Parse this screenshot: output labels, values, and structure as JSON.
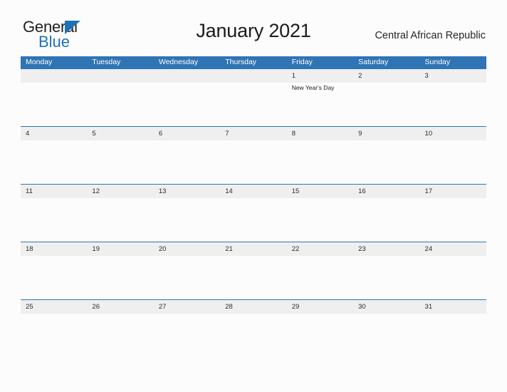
{
  "logo": {
    "word_one": "General",
    "word_two": "Blue",
    "triangle_icon": "triangle-icon",
    "brand_color": "#1f72ba",
    "text_color": "#231f20"
  },
  "header": {
    "title": "January 2021",
    "region": "Central African Republic"
  },
  "calendar": {
    "month": "January",
    "year": "2021",
    "header_bg": "#2f74b5",
    "date_band_bg": "#efefef",
    "weekdays": [
      "Monday",
      "Tuesday",
      "Wednesday",
      "Thursday",
      "Friday",
      "Saturday",
      "Sunday"
    ],
    "weeks": [
      [
        {
          "date": "",
          "events": []
        },
        {
          "date": "",
          "events": []
        },
        {
          "date": "",
          "events": []
        },
        {
          "date": "",
          "events": []
        },
        {
          "date": "1",
          "events": [
            "New Year's Day"
          ]
        },
        {
          "date": "2",
          "events": []
        },
        {
          "date": "3",
          "events": []
        }
      ],
      [
        {
          "date": "4",
          "events": []
        },
        {
          "date": "5",
          "events": []
        },
        {
          "date": "6",
          "events": []
        },
        {
          "date": "7",
          "events": []
        },
        {
          "date": "8",
          "events": []
        },
        {
          "date": "9",
          "events": []
        },
        {
          "date": "10",
          "events": []
        }
      ],
      [
        {
          "date": "11",
          "events": []
        },
        {
          "date": "12",
          "events": []
        },
        {
          "date": "13",
          "events": []
        },
        {
          "date": "14",
          "events": []
        },
        {
          "date": "15",
          "events": []
        },
        {
          "date": "16",
          "events": []
        },
        {
          "date": "17",
          "events": []
        }
      ],
      [
        {
          "date": "18",
          "events": []
        },
        {
          "date": "19",
          "events": []
        },
        {
          "date": "20",
          "events": []
        },
        {
          "date": "21",
          "events": []
        },
        {
          "date": "22",
          "events": []
        },
        {
          "date": "23",
          "events": []
        },
        {
          "date": "24",
          "events": []
        }
      ],
      [
        {
          "date": "25",
          "events": []
        },
        {
          "date": "26",
          "events": []
        },
        {
          "date": "27",
          "events": []
        },
        {
          "date": "28",
          "events": []
        },
        {
          "date": "29",
          "events": []
        },
        {
          "date": "30",
          "events": []
        },
        {
          "date": "31",
          "events": []
        }
      ]
    ]
  }
}
